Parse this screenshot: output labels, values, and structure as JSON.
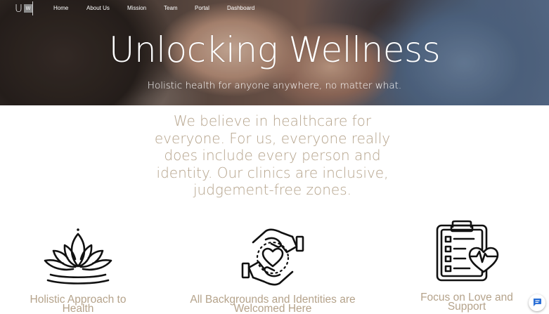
{
  "logo": {
    "letter_u": "U",
    "letter_w": "W"
  },
  "nav": {
    "items": [
      {
        "label": "Home"
      },
      {
        "label": "About Us"
      },
      {
        "label": "Mission"
      },
      {
        "label": "Team"
      },
      {
        "label": "Portal"
      },
      {
        "label": "Dashboard"
      }
    ]
  },
  "hero": {
    "title": "Unlocking Wellness",
    "subtitle": "Holistic health for anyone anywhere, no matter what."
  },
  "mission": {
    "text": "We believe in healthcare for everyone. For us, everyone really does include every person and identity. Our clinics are inclusive, judgement-free zones."
  },
  "features": [
    {
      "icon": "lotus-icon",
      "label": "Holistic Approach to Health"
    },
    {
      "icon": "caring-hands-heart-icon",
      "label": "All Backgrounds and Identities are Welcomed Here"
    },
    {
      "icon": "clipboard-heartbeat-icon",
      "label": "Focus on Love and Support"
    }
  ],
  "colors": {
    "accent_text": "#b5a38b",
    "chat_icon": "#2b6fd6"
  },
  "chat": {
    "icon": "chat-bubble-icon"
  }
}
